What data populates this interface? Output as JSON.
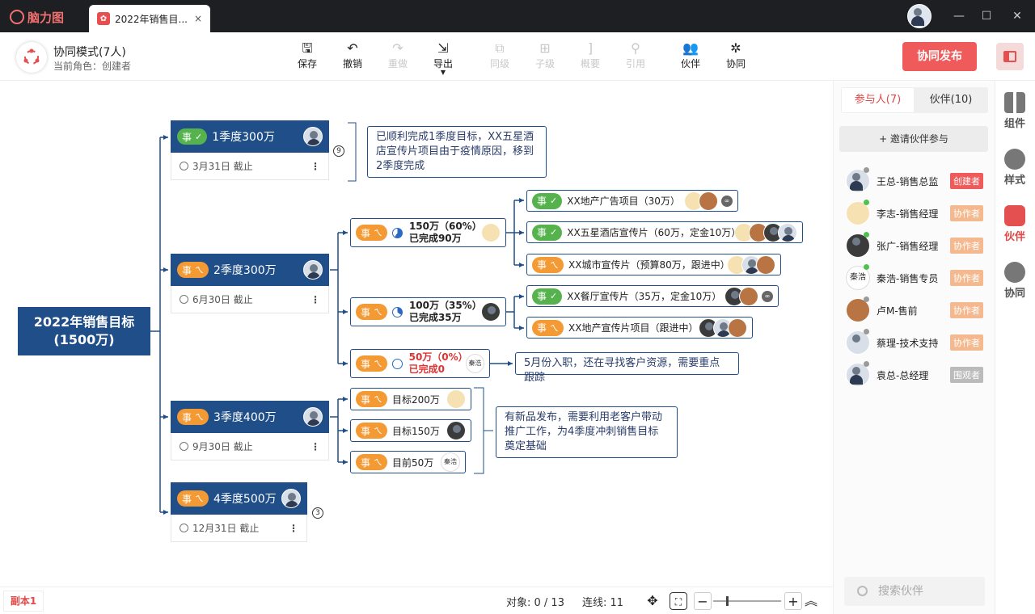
{
  "app": {
    "name": "脑力图",
    "tab_title": "2022年销售目...",
    "tab_close": "×"
  },
  "window": {
    "minimize": "—",
    "maximize": "☐",
    "close": "✕"
  },
  "mode": {
    "title": "协同模式(7人)",
    "role": "当前角色：创建者"
  },
  "toolbar": {
    "save": "保存",
    "undo": "撤销",
    "redo": "重做",
    "export": "导出",
    "sibling": "同级",
    "child": "子级",
    "summary": "概要",
    "reference": "引用",
    "partner": "伙伴",
    "collab": "协同",
    "publish": "协同发布"
  },
  "mindmap": {
    "root": {
      "line1": "2022年销售目标",
      "line2": "(1500万)"
    },
    "tag": "事",
    "quarters": [
      {
        "title": "1季度300万",
        "deadline": "3月31日 截止",
        "more": "⋮",
        "count": "9"
      },
      {
        "title": "2季度300万",
        "deadline": "6月30日 截止",
        "more": "⋮"
      },
      {
        "title": "3季度400万",
        "deadline": "9月30日 截止",
        "more": "⋮"
      },
      {
        "title": "4季度500万",
        "deadline": "12月31日 截止",
        "more": "⋮",
        "count": "3"
      }
    ],
    "q1_note": "已顺利完成1季度目标，XX五星酒店宣传片项目由于疫情原因，移到2季度完成",
    "q2_people": [
      {
        "line1": "150万（60%）",
        "line2": "已完成90万",
        "progress": 0.6
      },
      {
        "line1": "100万（35%）",
        "line2": "已完成35万",
        "progress": 0.35
      },
      {
        "line1": "50万（0%）",
        "line2": "已完成0",
        "progress": 0.0,
        "avatar_text": "秦浩"
      }
    ],
    "q2_tasks": [
      {
        "label": "XX地产广告项目（30万）"
      },
      {
        "label": "XX五星酒店宣传片（60万，定金10万）"
      },
      {
        "label": "XX城市宣传片（预算80万，跟进中）"
      },
      {
        "label": "XX餐厅宣传片（35万，定金10万）"
      },
      {
        "label": "XX地产宣传片项目（跟进中）"
      }
    ],
    "q2_note3": "5月份入职，还在寻找客户资源，需要重点跟踪",
    "q3_items": [
      {
        "label": "目标200万"
      },
      {
        "label": "目标150万"
      },
      {
        "label": "目前50万",
        "avatar_text": "秦浩"
      }
    ],
    "q3_note": "有新品发布，需要利用老客户带动推广工作，为4季度冲刺销售目标奠定基础"
  },
  "statusbar": {
    "copy_tab": "副本1",
    "objects": "对象:  0 / 13",
    "links": "连线: 11",
    "zoom_out": "−",
    "zoom_in": "+"
  },
  "panel": {
    "tab_participants": "参与人(7)",
    "tab_partners": "伙伴(10)",
    "invite": "+ 邀请伙伴参与",
    "people": [
      {
        "name": "王总-销售总监",
        "role": "创建者",
        "online": false
      },
      {
        "name": "李志-销售经理",
        "role": "协作者",
        "online": true
      },
      {
        "name": "张广-销售经理",
        "role": "协作者",
        "online": true
      },
      {
        "name": "秦浩-销售专员",
        "role": "协作者",
        "online": true,
        "avatar_text": "秦浩"
      },
      {
        "name": "卢M-售前",
        "role": "协作者",
        "online": false
      },
      {
        "name": "蔡理-技术支持",
        "role": "协作者",
        "online": false
      },
      {
        "name": "袁总-总经理",
        "role": "围观者",
        "online": false
      }
    ],
    "search_placeholder": "搜索伙伴"
  },
  "sidebar": {
    "components": "组件",
    "style": "样式",
    "partners": "伙伴",
    "collab": "协同"
  },
  "colors": {
    "accent": "#ef5b5b",
    "node_blue": "#1f4e89",
    "tag_orange": "#f39a34",
    "tag_green": "#55b24d"
  }
}
